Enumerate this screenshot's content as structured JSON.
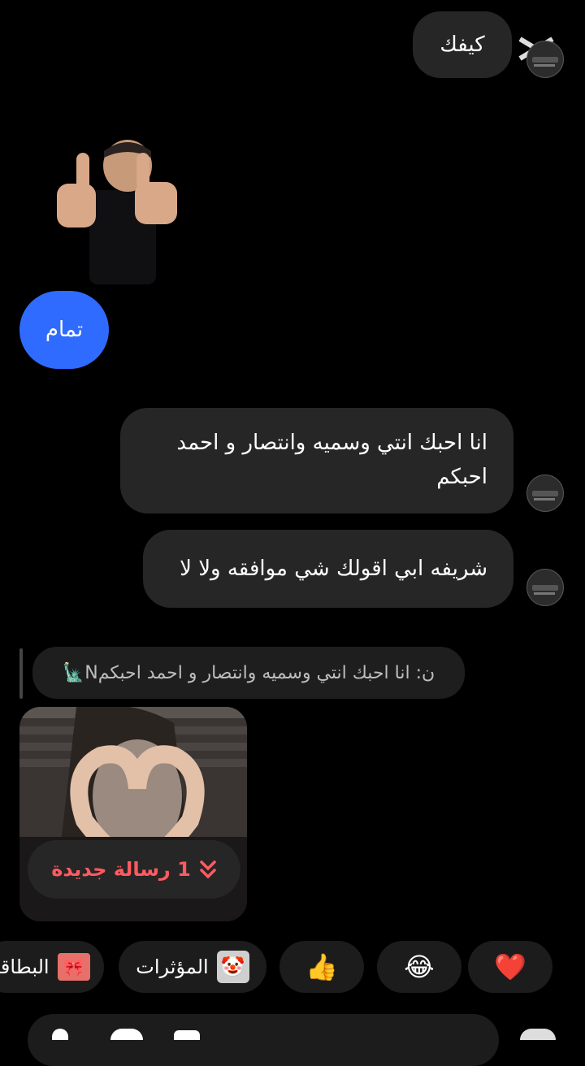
{
  "messages": {
    "m1": "كيفك",
    "m2": "تمام",
    "m3": "انا احبك انتي وسميه وانتصار و احمد احبكم",
    "m4": "شريفه ابي اقولك شي موافقه ولا لا"
  },
  "reply_preview": {
    "text": "ن: انا احبك انتي وسميه وانتصار و احمد احبكمN🗽"
  },
  "new_message_pill": {
    "label": "1 رسالة جديدة",
    "icon": "chevron-double-down-icon"
  },
  "quick_reactions": [
    {
      "label": "البطاقة",
      "icon": "ribbon-icon"
    },
    {
      "label": "المؤثرات",
      "icon": "face-effect-icon"
    },
    {
      "emoji": "👍"
    },
    {
      "emoji": "😂"
    },
    {
      "emoji": "❤️"
    }
  ],
  "colors": {
    "accent": "#2f6bff",
    "bubble": "#262626",
    "pill_text": "#ff5a5f"
  }
}
